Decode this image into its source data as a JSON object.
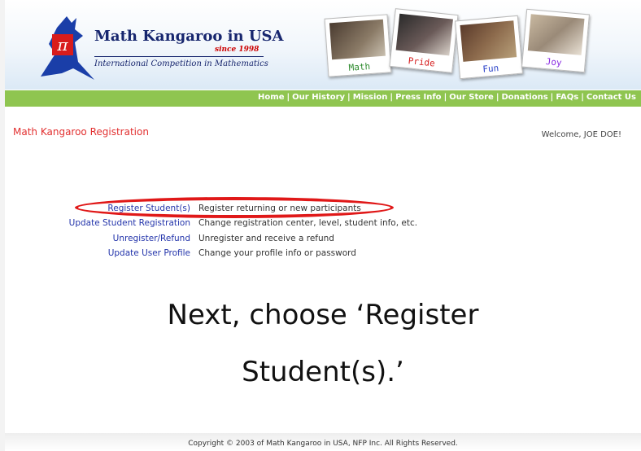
{
  "brand": {
    "title": "Math Kangaroo in USA",
    "since": "since 1998",
    "tagline": "International Competition in Mathematics",
    "logo_icon": "kangaroo-pi-icon"
  },
  "photos": [
    {
      "caption": "Math",
      "color": "#2e8b2e"
    },
    {
      "caption": "Pride",
      "color": "#d62020"
    },
    {
      "caption": "Fun",
      "color": "#2840c8"
    },
    {
      "caption": "Joy",
      "color": "#8a2be2"
    }
  ],
  "nav": {
    "items": [
      "Home",
      "Our History",
      "Mission",
      "Press Info",
      "Our Store",
      "Donations",
      "FAQs",
      "Contact Us"
    ]
  },
  "page": {
    "title": "Math Kangaroo Registration",
    "welcome": "Welcome, JOE DOE!"
  },
  "menu": [
    {
      "link": "Register Student(s)",
      "desc": "Register returning or new participants"
    },
    {
      "link": "Update Student Registration",
      "desc": "Change registration center, level, student info, etc."
    },
    {
      "link": "Unregister/Refund",
      "desc": "Unregister and receive a refund"
    },
    {
      "link": "Update User Profile",
      "desc": "Change your profile info or password"
    }
  ],
  "callout": {
    "line1": "Next, choose ‘Register",
    "line2": "Student(s).’"
  },
  "footer": {
    "copyright": "Copyright © 2003 of Math Kangaroo in USA, NFP Inc. All Rights Reserved."
  },
  "colors": {
    "brand_navy": "#17266e",
    "nav_green": "#8fc550",
    "highlight_red": "#e01818",
    "link_blue": "#2233aa"
  }
}
